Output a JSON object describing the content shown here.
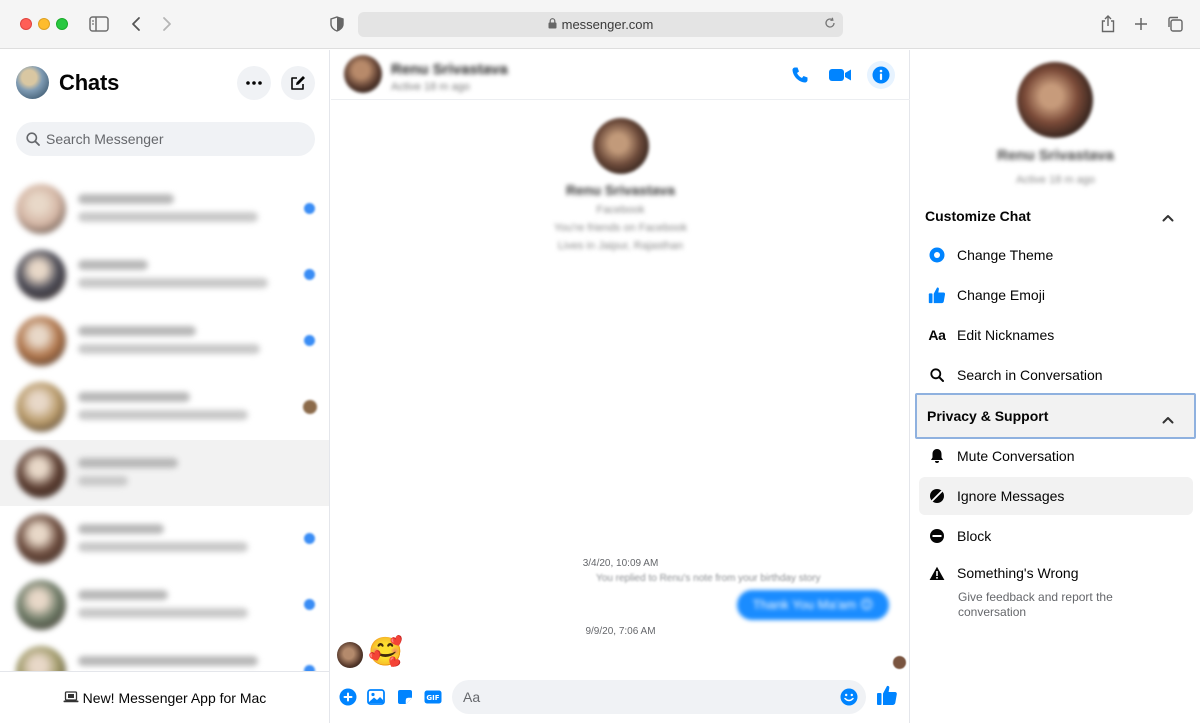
{
  "browser": {
    "url": "messenger.com"
  },
  "sidebar": {
    "title": "Chats",
    "search_placeholder": "Search Messenger",
    "promo": "New! Messenger App for Mac",
    "chats": [
      {
        "avatar_color": "#d4b6a5",
        "name_width": 96,
        "msg_width": 180,
        "indicator": "unread"
      },
      {
        "avatar_color": "#4a4a55",
        "name_width": 70,
        "msg_width": 190,
        "indicator": "unread"
      },
      {
        "avatar_color": "#b0764c",
        "name_width": 118,
        "msg_width": 182,
        "indicator": "unread"
      },
      {
        "avatar_color": "#b89a6a",
        "name_width": 112,
        "msg_width": 170,
        "indicator": "avatar"
      },
      {
        "avatar_color": "#5a3c30",
        "name_width": 100,
        "msg_width": 50,
        "indicator": "none",
        "active": true
      },
      {
        "avatar_color": "#6a4a3c",
        "name_width": 86,
        "msg_width": 170,
        "indicator": "unread"
      },
      {
        "avatar_color": "#6d7a66",
        "name_width": 90,
        "msg_width": 170,
        "indicator": "unread"
      },
      {
        "avatar_color": "#a09a6a",
        "name_width": 180,
        "msg_width": 0,
        "indicator": "unread"
      }
    ]
  },
  "conversation": {
    "contact_name": "Renu Srivastava",
    "contact_status": "Active 18 m ago",
    "intro_name": "Renu Srivastava",
    "intro_lines": [
      "Facebook",
      "You're friends on Facebook",
      "Lives in Jaipur, Rajasthan"
    ],
    "timestamp_1": "3/4/20, 10:09 AM",
    "reply_note": "You replied to Renu's note from your birthday story",
    "outgoing_bubble": "Thank You Ma'am 😊",
    "timestamp_2": "9/9/20, 7:06 AM",
    "incoming_emoji": "🥰",
    "composer_placeholder": "Aa",
    "accent_color": "#0084ff"
  },
  "info_panel": {
    "name": "Renu Srivastava",
    "status": "Active 18 m ago",
    "customize_header": "Customize Chat",
    "customize_items": [
      {
        "label": "Change Theme",
        "icon": "theme-icon"
      },
      {
        "label": "Change Emoji",
        "icon": "thumbs-up-icon"
      },
      {
        "label": "Edit Nicknames",
        "icon": "nickname-icon",
        "glyph": "Aa"
      },
      {
        "label": "Search in Conversation",
        "icon": "search-icon"
      }
    ],
    "privacy_header": "Privacy & Support",
    "privacy_items": [
      {
        "label": "Mute Conversation",
        "icon": "bell-icon"
      },
      {
        "label": "Ignore Messages",
        "icon": "ignore-icon"
      },
      {
        "label": "Block",
        "icon": "block-icon"
      },
      {
        "label": "Something's Wrong",
        "icon": "warning-icon"
      }
    ],
    "something_wrong_sub": "Give feedback and report the conversation"
  }
}
